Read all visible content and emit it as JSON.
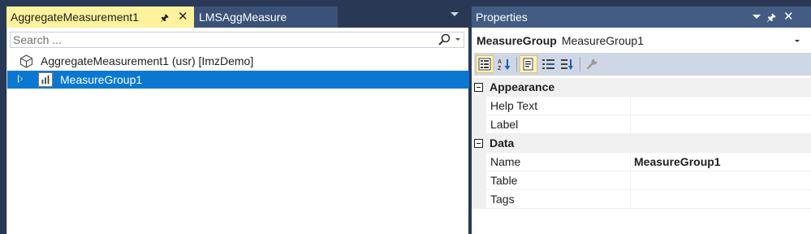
{
  "tabs": [
    {
      "label": "AggregateMeasurement1",
      "active": true
    },
    {
      "label": "LMSAggMeasure",
      "active": false
    }
  ],
  "search": {
    "placeholder": "Search ..."
  },
  "tree": {
    "root_label": "AggregateMeasurement1 (usr) [ImzDemo]",
    "selected_label": "MeasureGroup1"
  },
  "properties": {
    "title": "Properties",
    "object_type": "MeasureGroup",
    "object_name": "MeasureGroup1",
    "categories": [
      {
        "label": "Appearance",
        "rows": [
          {
            "name": "Help Text",
            "value": ""
          },
          {
            "name": "Label",
            "value": ""
          }
        ]
      },
      {
        "label": "Data",
        "rows": [
          {
            "name": "Name",
            "value": "MeasureGroup1"
          },
          {
            "name": "Table",
            "value": ""
          },
          {
            "name": "Tags",
            "value": ""
          }
        ]
      }
    ]
  },
  "colors": {
    "active_tab": "#fff29d",
    "selection": "#0a78d3",
    "title_bar": "#425c84",
    "chrome": "#293955"
  }
}
